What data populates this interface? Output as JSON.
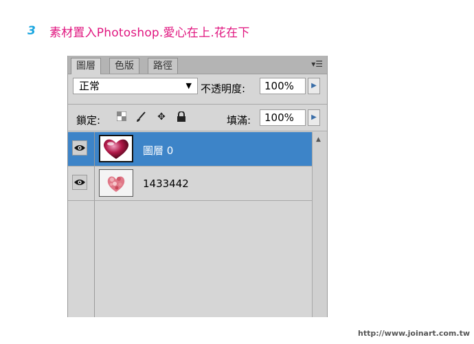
{
  "step": {
    "number": "3",
    "title": "素材置入Photoshop.愛心在上.花在下"
  },
  "panel": {
    "tabs": [
      {
        "label": "圖層",
        "active": true
      },
      {
        "label": "色版",
        "active": false
      },
      {
        "label": "路徑",
        "active": false
      }
    ],
    "menu_icon": "panel-menu-icon",
    "blend_mode": "正常",
    "opacity_label": "不透明度:",
    "opacity_value": "100%",
    "lock_label": "鎖定:",
    "lock_icons": [
      "lock-transparent-icon",
      "lock-paint-brush-icon",
      "lock-move-icon",
      "lock-all-icon"
    ],
    "fill_label": "填滿:",
    "fill_value": "100%",
    "layers": [
      {
        "name": "圖層 0",
        "visible": true,
        "selected": true,
        "thumbnail": "heart-thumbnail"
      },
      {
        "name": "1433442",
        "visible": true,
        "selected": false,
        "thumbnail": "flower-heart-thumbnail"
      }
    ],
    "colors": {
      "selection": "#3d84c8",
      "panel_bg": "#d6d6d6"
    }
  },
  "footer": {
    "url": "http://www.joinart.com.tw"
  },
  "colors": {
    "step_number": "#1aa6e0",
    "step_title": "#e0157f"
  }
}
